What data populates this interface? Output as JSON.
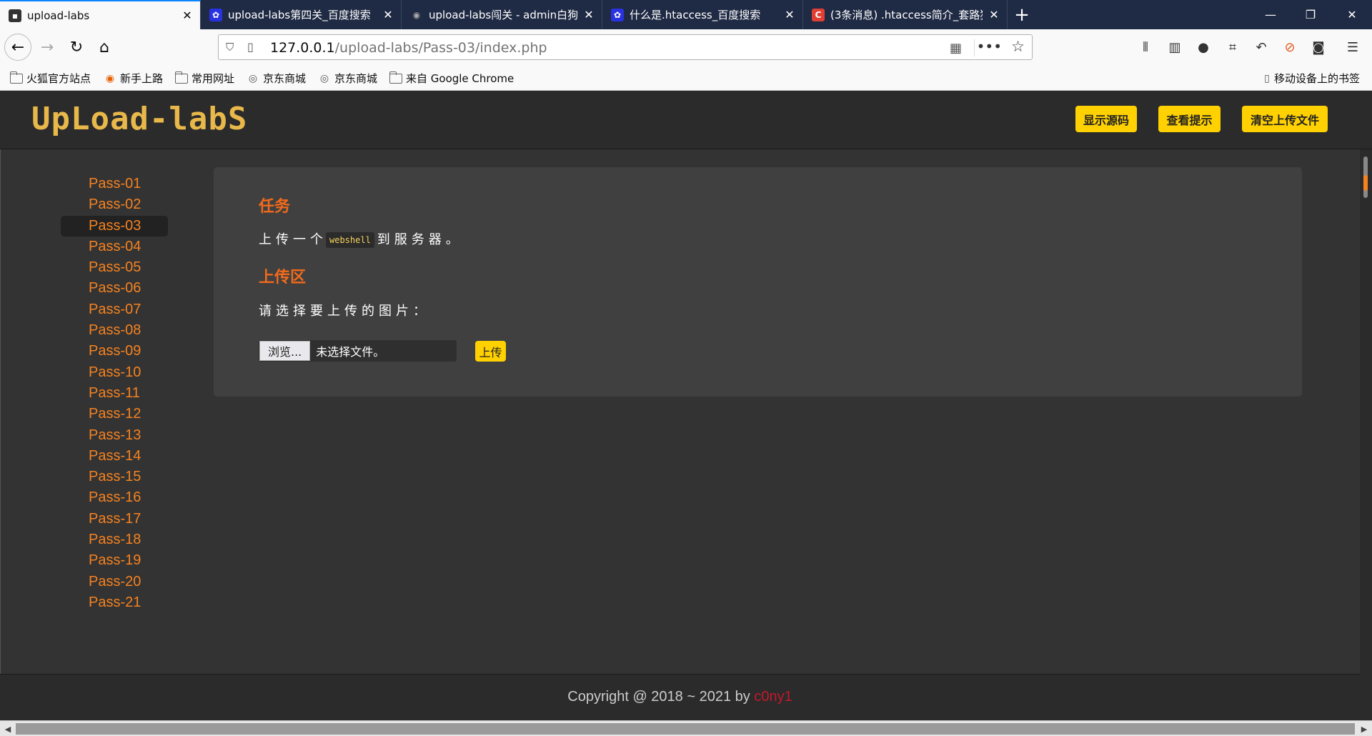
{
  "tabs": [
    {
      "title": "upload-labs",
      "active": true
    },
    {
      "title": "upload-labs第四关_百度搜索",
      "active": false
    },
    {
      "title": "upload-labs闯关 - admin白狗",
      "active": false
    },
    {
      "title": "什么是.htaccess_百度搜索",
      "active": false
    },
    {
      "title": "(3条消息) .htaccess简介_套路狗",
      "active": false
    }
  ],
  "url": {
    "host": "127.0.0.1",
    "path": "/upload-labs/Pass-03/index.php"
  },
  "bookmarks": [
    {
      "label": "火狐官方站点",
      "icon": "folder-icon"
    },
    {
      "label": "新手上路",
      "icon": "firefox-icon"
    },
    {
      "label": "常用网址",
      "icon": "folder-icon"
    },
    {
      "label": "京东商城",
      "icon": "globe-icon"
    },
    {
      "label": "京东商城",
      "icon": "globe-icon"
    },
    {
      "label": "来自 Google Chrome",
      "icon": "folder-icon"
    }
  ],
  "mobile_bookmarks": "移动设备上的书签",
  "header": {
    "logo": "UpLoad-labS",
    "buttons": [
      "显示源码",
      "查看提示",
      "清空上传文件"
    ]
  },
  "sidebar": {
    "active": "Pass-03",
    "items": [
      "Pass-01",
      "Pass-02",
      "Pass-03",
      "Pass-04",
      "Pass-05",
      "Pass-06",
      "Pass-07",
      "Pass-08",
      "Pass-09",
      "Pass-10",
      "Pass-11",
      "Pass-12",
      "Pass-13",
      "Pass-14",
      "Pass-15",
      "Pass-16",
      "Pass-17",
      "Pass-18",
      "Pass-19",
      "Pass-20",
      "Pass-21"
    ]
  },
  "panel": {
    "task_heading": "任务",
    "task_before": "上传一个",
    "task_code": "webshell",
    "task_after": "到服务器。",
    "upload_heading": "上传区",
    "prompt": "请选择要上传的图片：",
    "browse_label": "浏览...",
    "file_status": "未选择文件。",
    "upload_label": "上传"
  },
  "footer": {
    "text": "Copyright @ 2018 ~ 2021 by ",
    "author": "c0ny1"
  },
  "colors": {
    "accent": "#f58220",
    "button": "#ffd100",
    "heading": "#f26a1b",
    "background": "#333333"
  }
}
